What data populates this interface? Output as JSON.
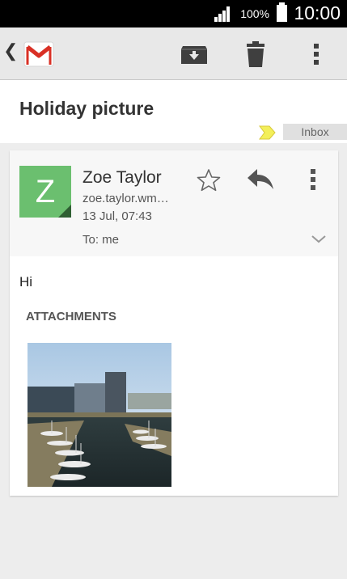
{
  "status_bar": {
    "signal": "signal-icon",
    "battery_percent": "100%",
    "battery": "battery-icon",
    "time": "10:00"
  },
  "action_bar": {
    "back": "chevron-left-icon",
    "app_logo": "gmail-icon",
    "actions": [
      "archive-icon",
      "delete-icon",
      "more-vert-icon"
    ]
  },
  "email": {
    "subject": "Holiday picture",
    "label": "Inbox",
    "label_color": "#f3ef5a",
    "sender": {
      "initial": "Z",
      "avatar_color": "#6bbf6f",
      "name": "Zoe Taylor",
      "email": "zoe.taylor.wm…",
      "date": "13 Jul, 07:43"
    },
    "to_line": "To: me",
    "body": "Hi",
    "attachments_heading": "ATTACHMENTS",
    "attachment_icon": "image-thumbnail-icon"
  }
}
